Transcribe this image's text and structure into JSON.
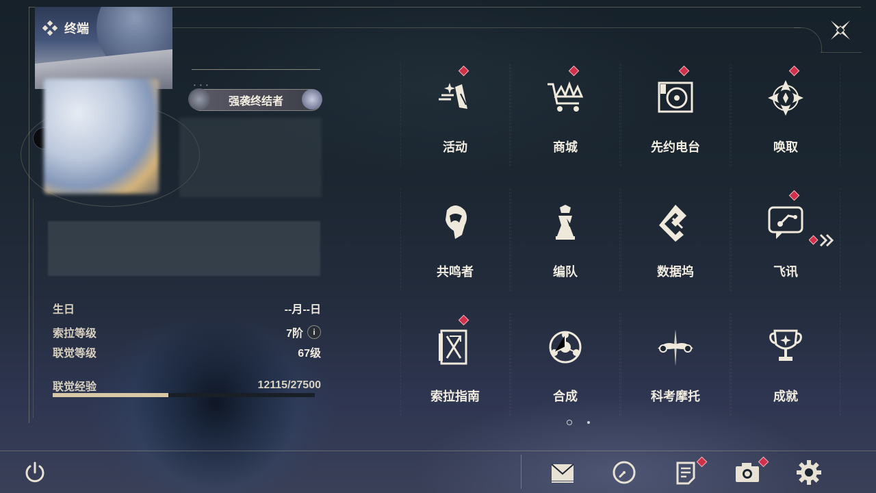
{
  "header": {
    "title": "终端",
    "title_icon": "diamond-cluster-icon",
    "close_icon": "close-icon"
  },
  "profile": {
    "title_badge": "强袭终结者",
    "stats": {
      "birthday_label": "生日",
      "birthday_value": "--月--日",
      "sola_level_label": "索拉等级",
      "sola_level_value": "7阶",
      "union_level_label": "联觉等级",
      "union_level_value": "67级",
      "union_exp_label": "联觉经验",
      "union_exp_value": "12115/27500",
      "union_exp_fraction": 0.4405
    },
    "info_icon_glyph": "i"
  },
  "menu": {
    "items": [
      {
        "label": "活动",
        "icon": "event-icon",
        "badge": true
      },
      {
        "label": "商城",
        "icon": "shop-cart-icon",
        "badge": true
      },
      {
        "label": "先约电台",
        "icon": "radio-icon",
        "badge": true
      },
      {
        "label": "唤取",
        "icon": "convene-icon",
        "badge": true
      },
      {
        "label": "共鸣者",
        "icon": "resonator-icon",
        "badge": false
      },
      {
        "label": "编队",
        "icon": "chess-team-icon",
        "badge": false
      },
      {
        "label": "数据坞",
        "icon": "data-bank-icon",
        "badge": false
      },
      {
        "label": "飞讯",
        "icon": "message-icon",
        "badge": true
      },
      {
        "label": "索拉指南",
        "icon": "guide-icon",
        "badge": true
      },
      {
        "label": "合成",
        "icon": "synthesis-icon",
        "badge": false
      },
      {
        "label": "科考摩托",
        "icon": "motorcycle-icon",
        "badge": false
      },
      {
        "label": "成就",
        "icon": "trophy-icon",
        "badge": false
      }
    ],
    "next_page_icon": "double-chevron-right-icon",
    "page_count": 2,
    "current_page": 1
  },
  "bottom_bar": {
    "power_icon": "power-icon",
    "icons": [
      "mail-icon",
      "clock-icon",
      "notice-icon",
      "camera-icon",
      "settings-gear-icon"
    ],
    "badges": [
      false,
      false,
      true,
      true,
      false
    ]
  },
  "colors": {
    "badge_red": "#d0304a",
    "exp_fill": "#d9c8a6",
    "text_primary": "#f1ece0"
  }
}
